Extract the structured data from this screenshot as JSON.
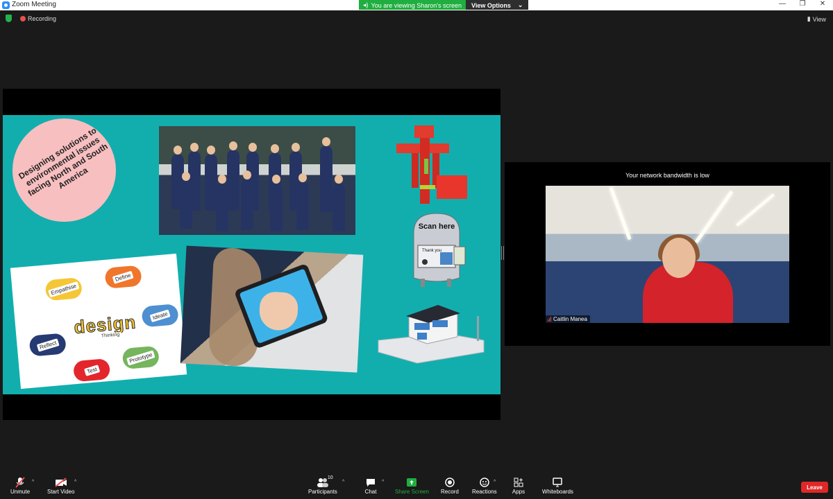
{
  "window": {
    "title": "Zoom Meeting",
    "minimize": "—",
    "restore": "❐",
    "close": "✕"
  },
  "banner": {
    "viewing": "You are viewing Sharon's screen",
    "view_options": "View Options"
  },
  "status": {
    "recording": "Recording",
    "view": "View"
  },
  "slide": {
    "circle_text": "Designing solutions to environmental issues facing North and South America",
    "design_steps": [
      {
        "label": "Empathise",
        "color": "#f5c636"
      },
      {
        "label": "Define",
        "color": "#f0762b"
      },
      {
        "label": "Ideate",
        "color": "#4e8fd1"
      },
      {
        "label": "Reflect",
        "color": "#263a73"
      },
      {
        "label": "Test",
        "color": "#e3262c"
      },
      {
        "label": "Prototype",
        "color": "#75b55d"
      }
    ],
    "design_word": "design",
    "design_sub": "Thinking",
    "scan_here": "Scan here",
    "thank_you": "Thank you"
  },
  "video": {
    "bandwidth_msg": "Your network bandwidth is low",
    "participant_name": "Caitlin Manea"
  },
  "toolbar": {
    "unmute": "Unmute",
    "start_video": "Start Video",
    "participants": "Participants",
    "participants_count": "10",
    "chat": "Chat",
    "share_screen": "Share Screen",
    "record": "Record",
    "reactions": "Reactions",
    "apps": "Apps",
    "whiteboards": "Whiteboards",
    "leave": "Leave"
  },
  "colors": {
    "share_green": "#1fae3f",
    "slide_teal": "#12aeae",
    "leave_red": "#e02828",
    "circle_pink": "#f8bfc0"
  }
}
